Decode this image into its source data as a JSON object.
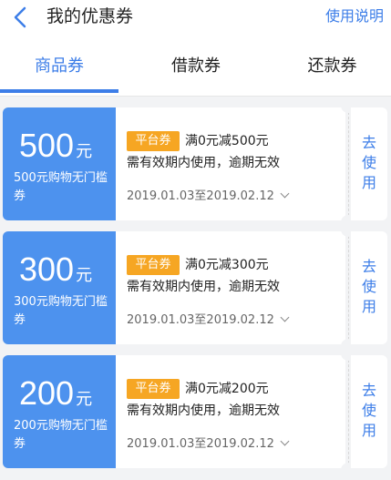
{
  "header": {
    "title": "我的优惠券",
    "help_label": "使用说明"
  },
  "tabs": [
    {
      "label": "商品券",
      "active": true
    },
    {
      "label": "借款券",
      "active": false
    },
    {
      "label": "还款券",
      "active": false
    }
  ],
  "colors": {
    "accent": "#3d7ee8",
    "coupon_left": "#4d92ee",
    "badge": "#f6a623"
  },
  "coupons": [
    {
      "amount": "500",
      "unit": "元",
      "desc": "500元购物无门槛券",
      "badge": "平台券",
      "condition": "满0元减500元",
      "note": "需有效期内使用，逾期无效",
      "validity": "2019.01.03至2019.02.12",
      "use_label_1": "去",
      "use_label_2": "使",
      "use_label_3": "用"
    },
    {
      "amount": "300",
      "unit": "元",
      "desc": "300元购物无门槛券",
      "badge": "平台券",
      "condition": "满0元减300元",
      "note": "需有效期内使用，逾期无效",
      "validity": "2019.01.03至2019.02.12",
      "use_label_1": "去",
      "use_label_2": "使",
      "use_label_3": "用"
    },
    {
      "amount": "200",
      "unit": "元",
      "desc": "200元购物无门槛券",
      "badge": "平台券",
      "condition": "满0元减200元",
      "note": "需有效期内使用，逾期无效",
      "validity": "2019.01.03至2019.02.12",
      "use_label_1": "去",
      "use_label_2": "使",
      "use_label_3": "用"
    }
  ]
}
